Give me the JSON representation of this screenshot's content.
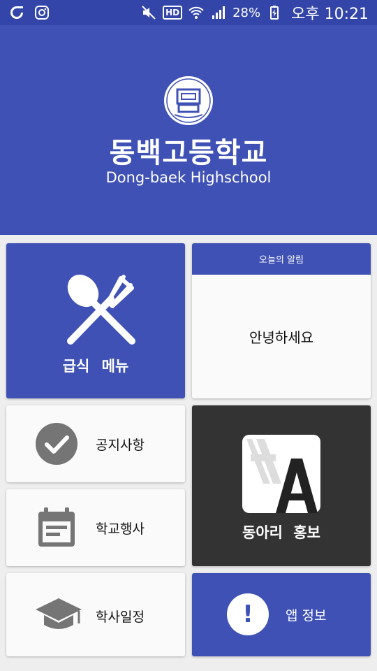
{
  "status_bar": {
    "battery": "28%",
    "clock": "오후 10:21",
    "hd_label": "HD",
    "icons": [
      "g-app-icon",
      "instagram-icon",
      "mute-icon",
      "hd-voice-icon",
      "wifi-icon",
      "signal-icon",
      "battery-charging-icon"
    ]
  },
  "header": {
    "logo_icon": "school-emblem-icon",
    "school_name": "동백고등학교",
    "school_name_en": "Dong-baek Highschool"
  },
  "tiles": {
    "meal": {
      "label": "급식 메뉴",
      "icon": "spoon-fork-icon"
    },
    "today_notice": {
      "header": "오늘의 알림",
      "message": "안녕하세요"
    },
    "announcements": {
      "label": "공지사항",
      "icon": "check-circle-icon"
    },
    "school_events": {
      "label": "학교행사",
      "icon": "calendar-icon"
    },
    "academic_schedule": {
      "label": "학사일정",
      "icon": "graduation-cap-icon"
    },
    "club_promo": {
      "label": "동아리 홍보",
      "icon": "club-logo-icon"
    },
    "app_info": {
      "label": "앱 정보",
      "icon": "info-icon",
      "symbol": "!"
    }
  },
  "colors": {
    "primary": "#3f51b5",
    "status_bar": "#3345a8",
    "dark_tile": "#333333",
    "light_tile": "#fafafa",
    "icon_grey": "#757575"
  }
}
